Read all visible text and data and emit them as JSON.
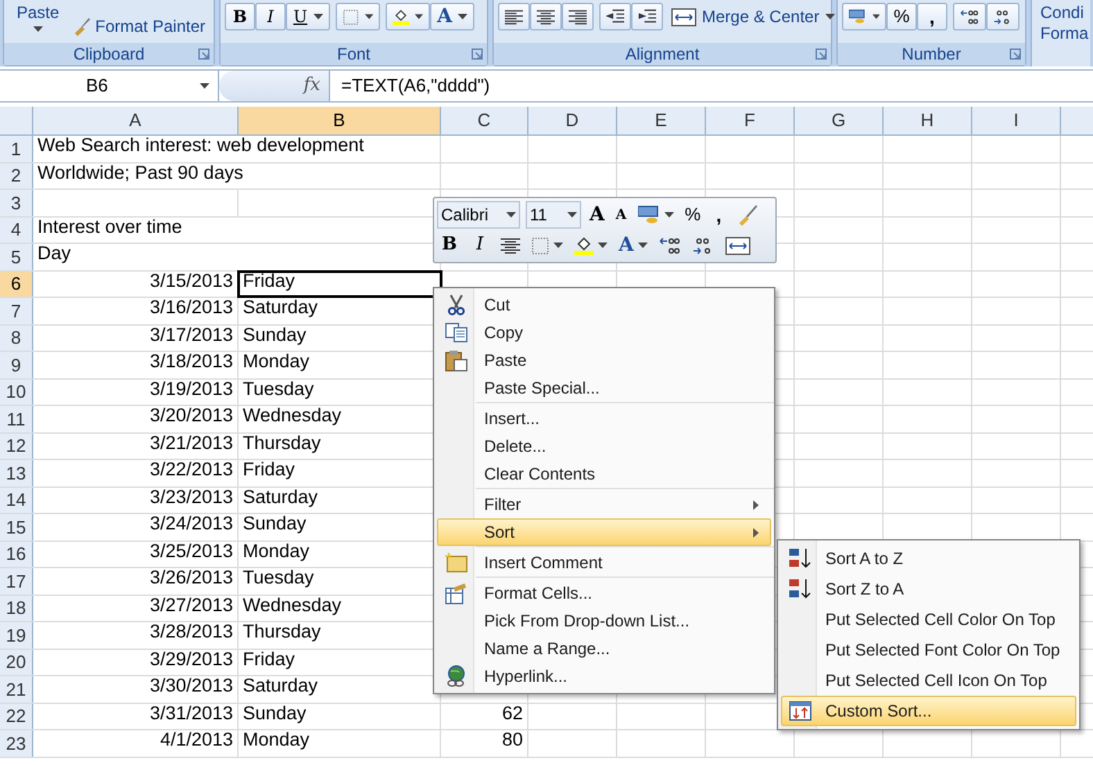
{
  "ribbon": {
    "clipboard": {
      "paste": "Paste",
      "format_painter": "Format Painter",
      "label": "Clipboard"
    },
    "font": {
      "bold": "B",
      "italic": "I",
      "underline": "U",
      "font_color": "A",
      "label": "Font"
    },
    "alignment": {
      "merge": "Merge & Center",
      "label": "Alignment"
    },
    "number": {
      "percent": "%",
      "comma": ",",
      "label": "Number"
    },
    "styles": {
      "conditional": "Condi",
      "format": "Forma"
    }
  },
  "formula_bar": {
    "name_box": "B6",
    "fx": "fx",
    "formula": "=TEXT(A6,\"dddd\")"
  },
  "sheet": {
    "columns": [
      {
        "label": "A",
        "selected": false
      },
      {
        "label": "B",
        "selected": true
      },
      {
        "label": "C",
        "selected": false
      },
      {
        "label": "D",
        "selected": false
      },
      {
        "label": "E",
        "selected": false
      },
      {
        "label": "F",
        "selected": false
      },
      {
        "label": "G",
        "selected": false
      },
      {
        "label": "H",
        "selected": false
      },
      {
        "label": "I",
        "selected": false
      }
    ],
    "rows": [
      {
        "label": "1",
        "selected": false,
        "a": "Web Search interest: web development"
      },
      {
        "label": "2",
        "selected": false,
        "a": "Worldwide; Past 90 days"
      },
      {
        "label": "3",
        "selected": false
      },
      {
        "label": "4",
        "selected": false,
        "a": "Interest over time"
      },
      {
        "label": "5",
        "selected": false,
        "a": "Day"
      },
      {
        "label": "6",
        "selected": true,
        "date": "3/15/2013",
        "b": "Friday"
      },
      {
        "label": "7",
        "selected": false,
        "date": "3/16/2013",
        "b": "Saturday"
      },
      {
        "label": "8",
        "selected": false,
        "date": "3/17/2013",
        "b": "Sunday"
      },
      {
        "label": "9",
        "selected": false,
        "date": "3/18/2013",
        "b": "Monday"
      },
      {
        "label": "10",
        "selected": false,
        "date": "3/19/2013",
        "b": "Tuesday"
      },
      {
        "label": "11",
        "selected": false,
        "date": "3/20/2013",
        "b": "Wednesday"
      },
      {
        "label": "12",
        "selected": false,
        "date": "3/21/2013",
        "b": "Thursday"
      },
      {
        "label": "13",
        "selected": false,
        "date": "3/22/2013",
        "b": "Friday"
      },
      {
        "label": "14",
        "selected": false,
        "date": "3/23/2013",
        "b": "Saturday"
      },
      {
        "label": "15",
        "selected": false,
        "date": "3/24/2013",
        "b": "Sunday"
      },
      {
        "label": "16",
        "selected": false,
        "date": "3/25/2013",
        "b": "Monday"
      },
      {
        "label": "17",
        "selected": false,
        "date": "3/26/2013",
        "b": "Tuesday"
      },
      {
        "label": "18",
        "selected": false,
        "date": "3/27/2013",
        "b": "Wednesday"
      },
      {
        "label": "19",
        "selected": false,
        "date": "3/28/2013",
        "b": "Thursday"
      },
      {
        "label": "20",
        "selected": false,
        "date": "3/29/2013",
        "b": "Friday"
      },
      {
        "label": "21",
        "selected": false,
        "date": "3/30/2013",
        "b": "Saturday"
      },
      {
        "label": "22",
        "selected": false,
        "date": "3/31/2013",
        "b": "Sunday",
        "c": "62"
      },
      {
        "label": "23",
        "selected": false,
        "date": "4/1/2013",
        "b": "Monday",
        "c": "80"
      }
    ]
  },
  "mini_toolbar": {
    "font": "Calibri",
    "size": "11",
    "grow": "A",
    "shrink": "A",
    "percent": "%",
    "comma": ",",
    "bold": "B",
    "italic": "I",
    "font_color": "A"
  },
  "context_menu": {
    "items": [
      {
        "kind": "item",
        "label": "Cut",
        "submenu": false,
        "selected": false
      },
      {
        "kind": "item",
        "label": "Copy",
        "submenu": false,
        "selected": false
      },
      {
        "kind": "item",
        "label": "Paste",
        "submenu": false,
        "selected": false
      },
      {
        "kind": "item",
        "label": "Paste Special...",
        "submenu": false,
        "selected": false
      },
      {
        "kind": "separator"
      },
      {
        "kind": "item",
        "label": "Insert...",
        "submenu": false,
        "selected": false
      },
      {
        "kind": "item",
        "label": "Delete...",
        "submenu": false,
        "selected": false
      },
      {
        "kind": "item",
        "label": "Clear Contents",
        "submenu": false,
        "selected": false
      },
      {
        "kind": "separator"
      },
      {
        "kind": "item",
        "label": "Filter",
        "submenu": true,
        "selected": false
      },
      {
        "kind": "item",
        "label": "Sort",
        "submenu": true,
        "selected": true
      },
      {
        "kind": "separator"
      },
      {
        "kind": "item",
        "label": "Insert Comment",
        "submenu": false,
        "selected": false
      },
      {
        "kind": "separator"
      },
      {
        "kind": "item",
        "label": "Format Cells...",
        "submenu": false,
        "selected": false
      },
      {
        "kind": "item",
        "label": "Pick From Drop-down List...",
        "submenu": false,
        "selected": false
      },
      {
        "kind": "item",
        "label": "Name a Range...",
        "submenu": false,
        "selected": false
      },
      {
        "kind": "item",
        "label": "Hyperlink...",
        "submenu": false,
        "selected": false
      }
    ]
  },
  "sort_submenu": {
    "items": [
      {
        "label": "Sort A to Z",
        "selected": false
      },
      {
        "label": "Sort Z to A",
        "selected": false
      },
      {
        "label": "Put Selected Cell Color On Top",
        "selected": false
      },
      {
        "label": "Put Selected Font Color On Top",
        "selected": false
      },
      {
        "label": "Put Selected Cell Icon On Top",
        "selected": false
      },
      {
        "label": "Custom Sort...",
        "selected": true
      }
    ]
  }
}
